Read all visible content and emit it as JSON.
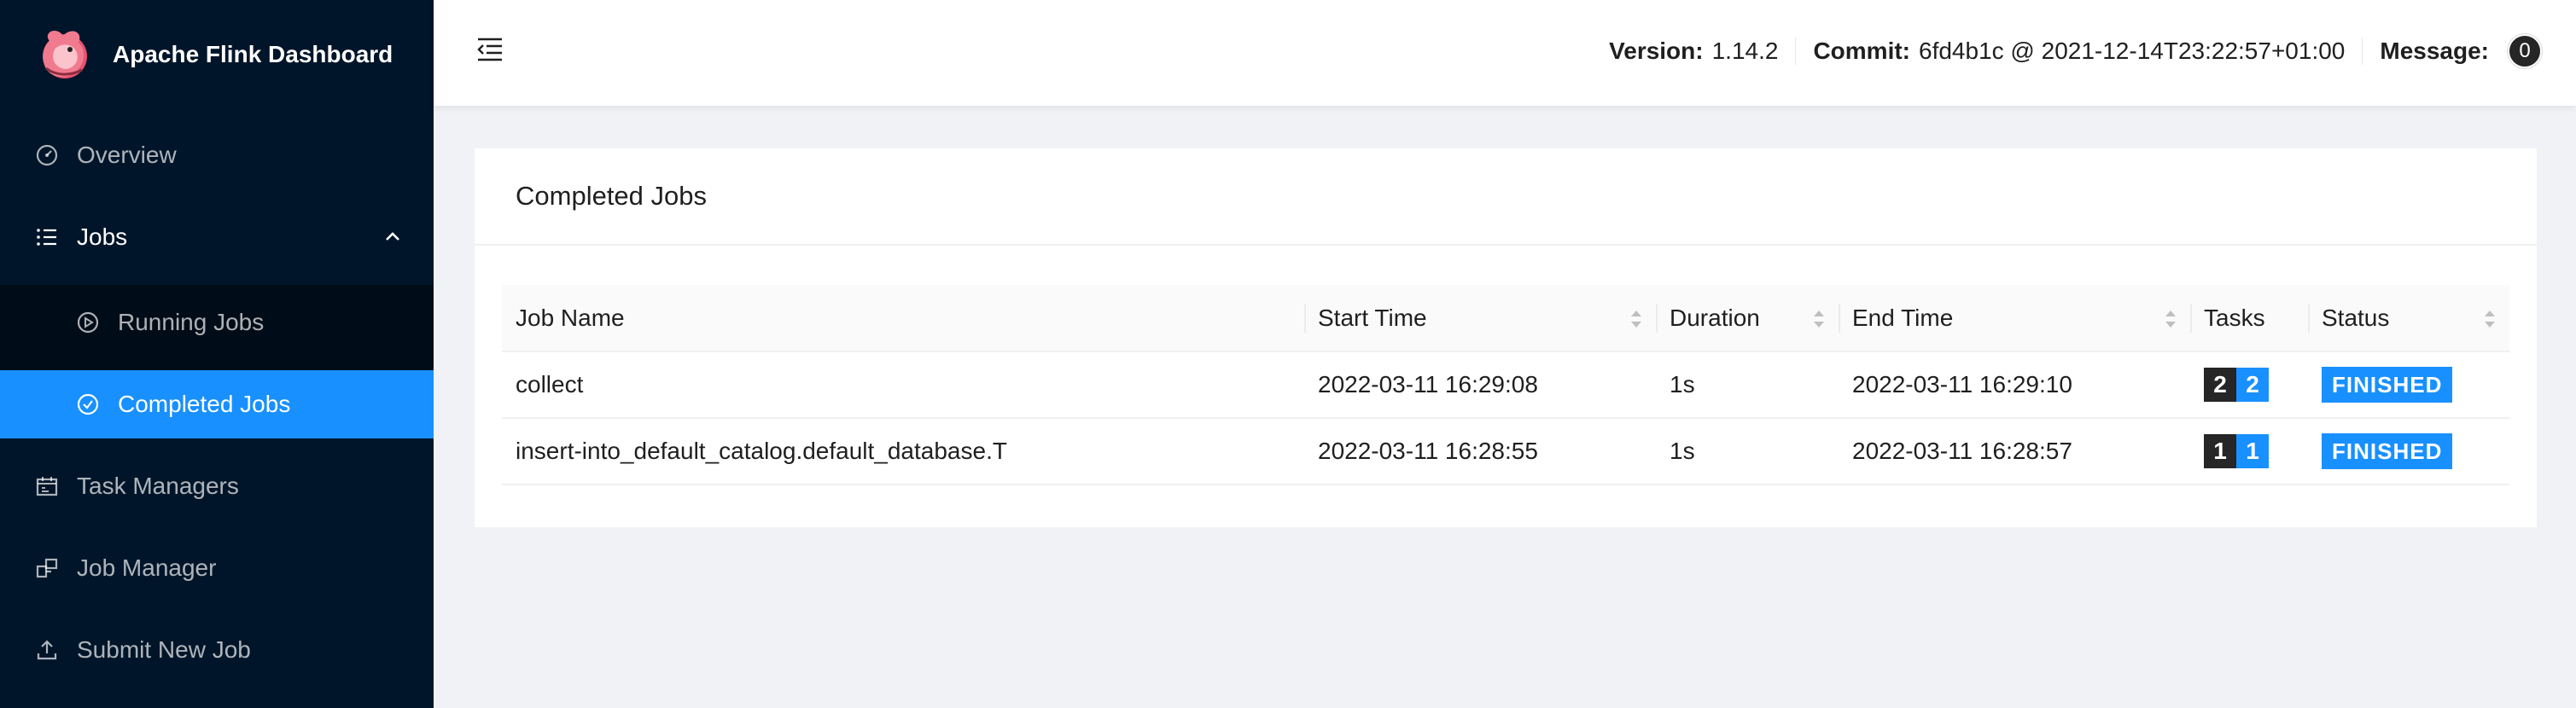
{
  "brand": {
    "title": "Apache Flink Dashboard",
    "logo_icon": "squirrel-logo-icon"
  },
  "sidebar": {
    "items": [
      {
        "label": "Overview",
        "icon": "dashboard-icon"
      },
      {
        "label": "Jobs",
        "icon": "unordered-list-icon"
      },
      {
        "label": "Running Jobs",
        "icon": "play-circle-icon"
      },
      {
        "label": "Completed Jobs",
        "icon": "check-circle-icon"
      },
      {
        "label": "Task Managers",
        "icon": "schedule-icon"
      },
      {
        "label": "Job Manager",
        "icon": "build-icon"
      },
      {
        "label": "Submit New Job",
        "icon": "upload-icon"
      }
    ]
  },
  "header": {
    "version_label": "Version:",
    "version_value": "1.14.2",
    "commit_label": "Commit:",
    "commit_value": "6fd4b1c @ 2021-12-14T23:22:57+01:00",
    "message_label": "Message:",
    "message_count": "0"
  },
  "card": {
    "title": "Completed Jobs",
    "columns": [
      "Job Name",
      "Start Time",
      "Duration",
      "End Time",
      "Tasks",
      "Status"
    ],
    "rows": [
      {
        "name": "collect",
        "start": "2022-03-11 16:29:08",
        "duration": "1s",
        "end": "2022-03-11 16:29:10",
        "tasks_total": "2",
        "tasks_finished": "2",
        "status": "FINISHED"
      },
      {
        "name": "insert-into_default_catalog.default_database.T",
        "start": "2022-03-11 16:28:55",
        "duration": "1s",
        "end": "2022-03-11 16:28:57",
        "tasks_total": "1",
        "tasks_finished": "1",
        "status": "FINISHED"
      }
    ]
  },
  "colors": {
    "sidebar_bg": "#001529",
    "submenu_bg": "#000c17",
    "accent": "#1890ff",
    "dark_badge": "#262626"
  }
}
